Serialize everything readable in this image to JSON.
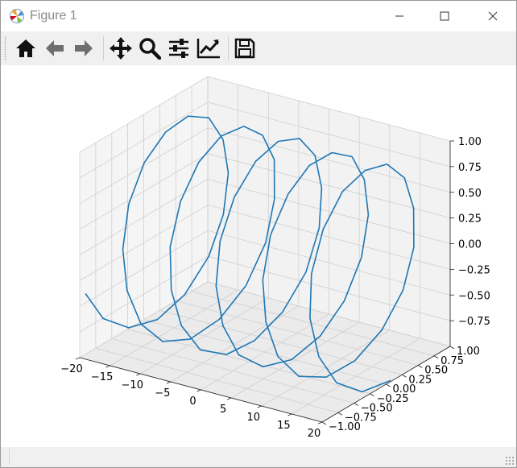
{
  "window": {
    "title": "Figure 1"
  },
  "toolbar": {
    "items": [
      {
        "icon": "home-icon",
        "tooltip": "Home"
      },
      {
        "icon": "back-arrow-icon",
        "tooltip": "Back"
      },
      {
        "icon": "forward-arrow-icon",
        "tooltip": "Forward"
      },
      {
        "icon": "pan-icon",
        "tooltip": "Pan"
      },
      {
        "icon": "zoom-icon",
        "tooltip": "Zoom"
      },
      {
        "icon": "subplots-icon",
        "tooltip": "Subplots"
      },
      {
        "icon": "edit-axis-icon",
        "tooltip": "Customize"
      },
      {
        "icon": "save-icon",
        "tooltip": "Save"
      }
    ]
  },
  "status": {
    "text": ""
  },
  "colors": {
    "line": "#1f77b4",
    "pane": "#f2f2f2",
    "grid": "#cfcfcf"
  },
  "chart_data": {
    "type": "line",
    "projection": "3d",
    "title": "",
    "xlabel": "",
    "ylabel": "",
    "zlabel": "",
    "xlim": [
      -20,
      20
    ],
    "ylim": [
      -1,
      1
    ],
    "zlim": [
      -1,
      1
    ],
    "x_ticks": [
      "−20",
      "−15",
      "−10",
      "−5",
      "0",
      "5",
      "10",
      "15",
      "20"
    ],
    "y_ticks": [
      "−1.00",
      "−0.75",
      "−0.50",
      "−0.25",
      "0.00",
      "0.25",
      "0.50",
      "0.75",
      "1.00"
    ],
    "z_ticks": [
      "−0.75",
      "−0.50",
      "−0.25",
      "0.00",
      "0.25",
      "0.50",
      "0.75",
      "1.00"
    ],
    "grid": true,
    "series": [
      {
        "x": [
          -20,
          -19.5,
          -19,
          -18.5,
          -18,
          -17.5,
          -17,
          -16.5,
          -16,
          -15.5,
          -15,
          -14.5,
          -14,
          -13.5,
          -13,
          -12.5,
          -12,
          -11.5,
          -11,
          -10.5,
          -10,
          -9.5,
          -9,
          -8.5,
          -8,
          -7.5,
          -7,
          -6.5,
          -6,
          -5.5,
          -5,
          -4.5,
          -4,
          -3.5,
          -3,
          -2.5,
          -2,
          -1.5,
          -1,
          -0.5,
          0,
          0.5,
          1,
          1.5,
          2,
          2.5,
          3,
          3.5,
          4,
          4.5,
          5,
          5.5,
          6,
          6.5,
          7,
          7.5,
          8,
          8.5,
          9,
          9.5,
          10,
          10.5,
          11,
          11.5,
          12,
          12.5,
          13,
          13.5,
          14,
          14.5,
          15,
          15.5,
          16,
          16.5,
          17,
          17.5,
          18,
          18.5,
          19,
          19.5,
          20
        ],
        "y": [
          -0.91,
          -0.68,
          -0.33,
          0.07,
          0.45,
          0.78,
          0.96,
          0.99,
          0.86,
          0.59,
          0.22,
          -0.18,
          -0.56,
          -0.85,
          -0.99,
          -0.97,
          -0.8,
          -0.51,
          -0.13,
          0.28,
          0.65,
          0.91,
          1.0,
          0.95,
          0.72,
          0.38,
          -0.02,
          -0.42,
          -0.75,
          -0.96,
          -0.99,
          -0.88,
          -0.63,
          -0.27,
          0.12,
          0.51,
          0.83,
          0.99,
          0.98,
          0.83,
          0.54,
          0.16,
          -0.24,
          -0.62,
          -0.89,
          -1.0,
          -0.94,
          -0.74,
          -0.41,
          -0.01,
          0.39,
          0.72,
          0.94,
          1.0,
          0.89,
          0.65,
          0.29,
          -0.11,
          -0.49,
          -0.81,
          -0.98,
          -0.98,
          -0.84,
          -0.56,
          -0.18,
          0.22,
          0.6,
          0.88,
          1.0,
          0.95,
          0.76,
          0.44,
          0.05,
          -0.35,
          -0.7,
          -0.93,
          -1.0,
          -0.91,
          -0.68,
          -0.33,
          0.07
        ],
        "z": [
          -0.41,
          -0.73,
          -0.94,
          -1.0,
          -0.89,
          -0.63,
          -0.28,
          0.12,
          0.5,
          0.82,
          0.98,
          0.98,
          0.83,
          0.54,
          0.16,
          -0.24,
          -0.62,
          -0.89,
          -1.0,
          -0.95,
          -0.75,
          -0.42,
          -0.02,
          0.39,
          0.72,
          0.94,
          1.0,
          0.9,
          0.65,
          0.29,
          -0.11,
          -0.49,
          -0.81,
          -0.98,
          -0.98,
          -0.84,
          -0.56,
          -0.18,
          0.22,
          0.6,
          0.88,
          1.0,
          0.96,
          0.76,
          0.44,
          0.05,
          -0.35,
          -0.7,
          -0.93,
          -1.0,
          -0.91,
          -0.68,
          -0.33,
          0.07,
          0.46,
          0.78,
          0.96,
          0.99,
          0.86,
          0.59,
          0.22,
          -0.18,
          -0.56,
          -0.85,
          -0.99,
          -0.97,
          -0.8,
          -0.51,
          -0.13,
          0.28,
          0.65,
          0.91,
          1.0,
          0.95,
          0.72,
          0.38,
          -0.02,
          -0.42,
          -0.75,
          -0.96,
          -0.99
        ]
      }
    ]
  }
}
